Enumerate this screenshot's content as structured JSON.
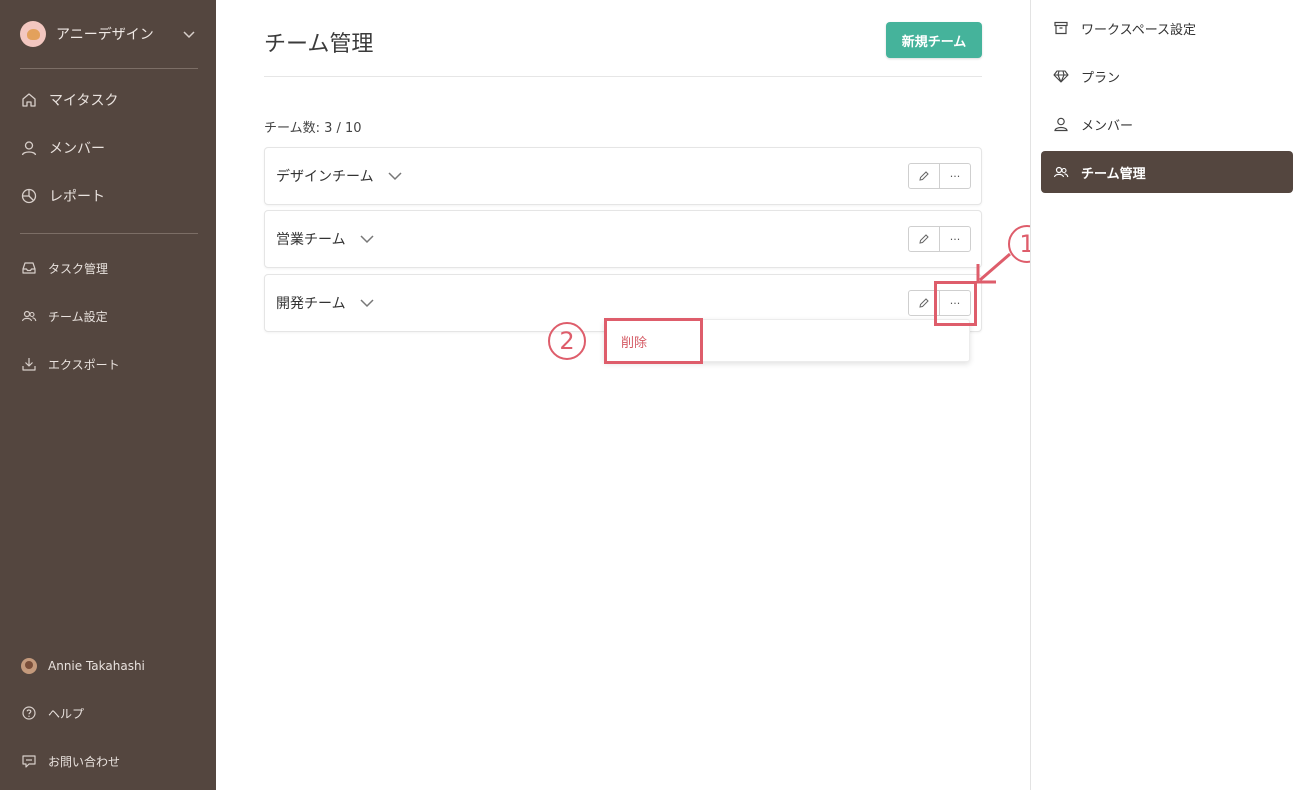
{
  "sidebar": {
    "workspace_name": "アニーデザイン",
    "primary_nav": [
      {
        "label": "マイタスク",
        "icon": "home-icon"
      },
      {
        "label": "メンバー",
        "icon": "user-icon"
      },
      {
        "label": "レポート",
        "icon": "pie-chart-icon"
      }
    ],
    "secondary_nav": [
      {
        "label": "タスク管理",
        "icon": "inbox-icon"
      },
      {
        "label": "チーム設定",
        "icon": "users-icon"
      },
      {
        "label": "エクスポート",
        "icon": "download-icon"
      }
    ],
    "footer_nav": [
      {
        "label": "Annie Takahashi",
        "icon": "avatar"
      },
      {
        "label": "ヘルプ",
        "icon": "help-circle-icon"
      },
      {
        "label": "お問い合わせ",
        "icon": "message-square-icon"
      }
    ]
  },
  "main": {
    "title": "チーム管理",
    "new_team_label": "新規チーム",
    "team_count": "チーム数: 3 / 10",
    "teams": [
      {
        "name": "デザインチーム"
      },
      {
        "name": "営業チーム"
      },
      {
        "name": "開発チーム"
      }
    ],
    "more_label": "···",
    "dropdown": {
      "delete_label": "削除"
    }
  },
  "annotations": {
    "step1": "1",
    "step2": "2"
  },
  "settings_panel": {
    "items": [
      {
        "label": "ワークスペース設定",
        "icon": "archive-icon",
        "active": false
      },
      {
        "label": "プラン",
        "icon": "diamond-icon",
        "active": false
      },
      {
        "label": "メンバー",
        "icon": "user-icon",
        "active": false
      },
      {
        "label": "チーム管理",
        "icon": "users-icon",
        "active": true
      }
    ]
  },
  "colors": {
    "sidebar_bg": "#54463f",
    "accent_green": "#45b39b",
    "annotation_red": "#de5d6b",
    "delete_text": "#d45a64"
  }
}
